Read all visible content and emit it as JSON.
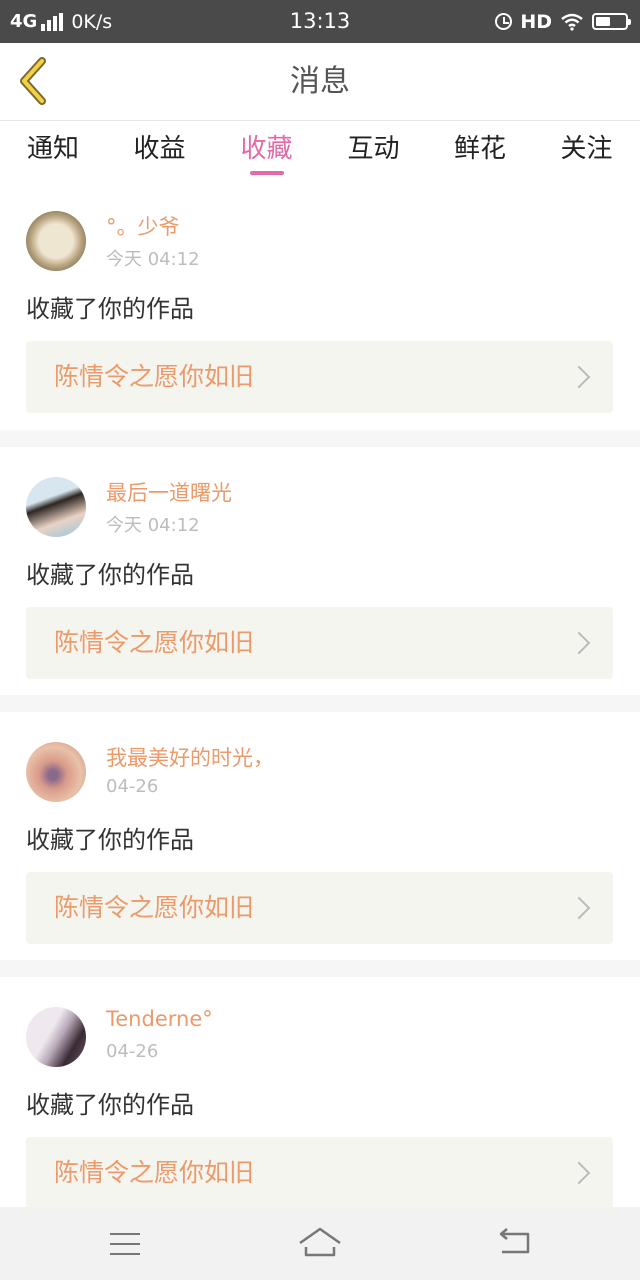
{
  "status_bar": {
    "network": "4G",
    "speed": "0K/s",
    "time": "13:13",
    "hd": "HD"
  },
  "header": {
    "title": "消息"
  },
  "tabs": [
    {
      "label": "通知",
      "active": false
    },
    {
      "label": "收益",
      "active": false
    },
    {
      "label": "收藏",
      "active": true
    },
    {
      "label": "互动",
      "active": false
    },
    {
      "label": "鲜花",
      "active": false
    },
    {
      "label": "关注",
      "active": false
    }
  ],
  "colors": {
    "accent": "#e36aa7",
    "username": "#ec9a6a",
    "status_bar": "#4a4a4a"
  },
  "messages": [
    {
      "username": "°。少爷",
      "time": "今天 04:12",
      "action": "收藏了你的作品",
      "work_title": "陈情令之愿你如旧"
    },
    {
      "username": "最后一道曙光",
      "time": "今天 04:12",
      "action": "收藏了你的作品",
      "work_title": "陈情令之愿你如旧"
    },
    {
      "username": "我最美好的时光，",
      "time": "04-26",
      "action": "收藏了你的作品",
      "work_title": "陈情令之愿你如旧"
    },
    {
      "username": "Tenderne°",
      "time": "04-26",
      "action": "收藏了你的作品",
      "work_title": "陈情令之愿你如旧"
    }
  ],
  "nav_icons": [
    "menu-icon",
    "home-icon",
    "back-icon"
  ]
}
